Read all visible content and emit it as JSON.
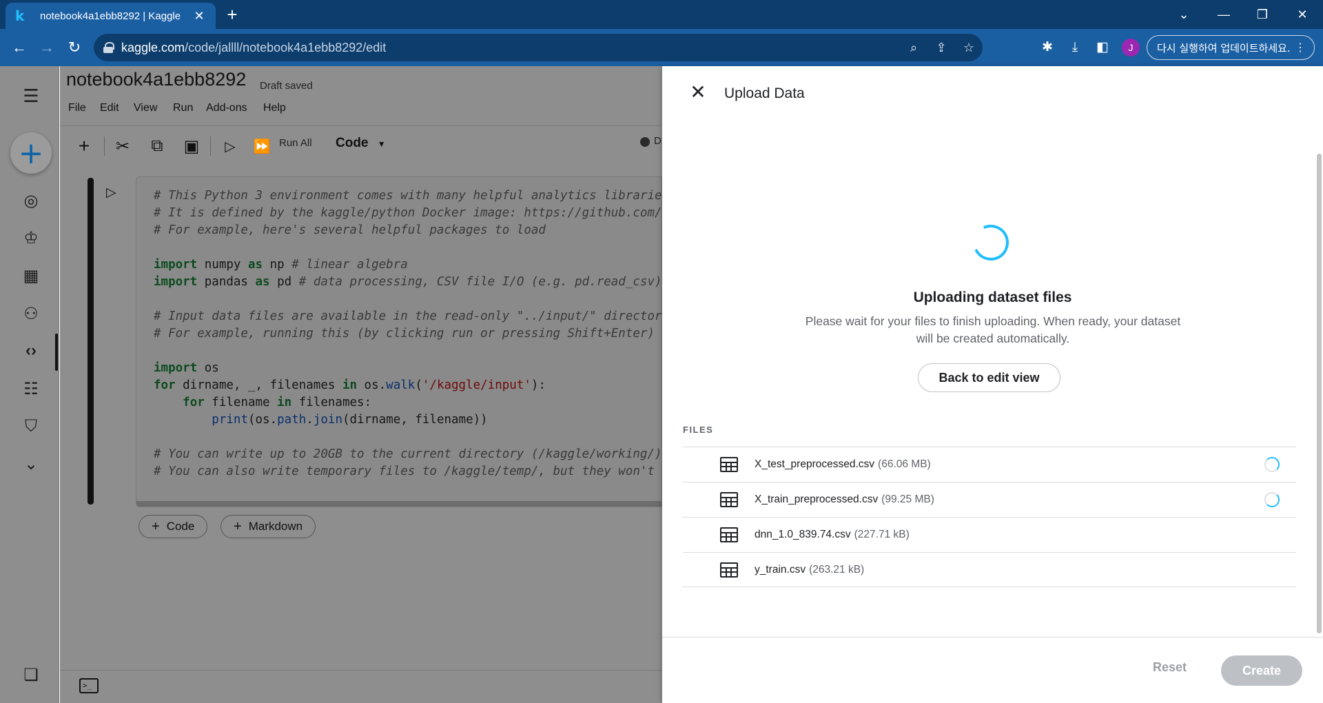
{
  "browser": {
    "tab_title": "notebook4a1ebb8292 | Kaggle",
    "tab_favicon": "k",
    "url_domain": "kaggle.com",
    "url_path": "/code/jallll/notebook4a1ebb8292/edit",
    "profile_initial": "J",
    "update_button_label": "다시 실행하여 업데이트하세요."
  },
  "notebook": {
    "title": "notebook4a1ebb8292",
    "save_status": "Draft saved",
    "menu": [
      "File",
      "Edit",
      "View",
      "Run",
      "Add-ons",
      "Help"
    ],
    "run_all_label": "Run All",
    "cell_type": "Code",
    "status_letter": "D",
    "add_code_label": "Code",
    "add_markdown_label": "Markdown"
  },
  "panel": {
    "title": "Upload Data",
    "uploading_title": "Uploading dataset files",
    "uploading_desc": "Please wait for your files to finish uploading. When ready, your dataset will be created automatically.",
    "back_button": "Back to edit view",
    "files_label": "FILES",
    "files": [
      {
        "name": "X_test_preprocessed.csv",
        "size": "(66.06 MB)",
        "uploading": true
      },
      {
        "name": "X_train_preprocessed.csv",
        "size": "(99.25 MB)",
        "uploading": true
      },
      {
        "name": "dnn_1.0_839.74.csv",
        "size": "(227.71 kB)",
        "uploading": false
      },
      {
        "name": "y_train.csv",
        "size": "(263.21 kB)",
        "uploading": false
      }
    ],
    "reset_label": "Reset",
    "create_label": "Create"
  },
  "colors": {
    "accent": "#20beff",
    "chrome_dark": "#0d3d6c",
    "chrome": "#1b5fa3"
  }
}
